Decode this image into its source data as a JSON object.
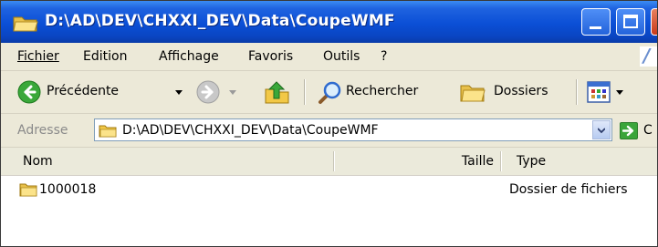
{
  "window": {
    "title": "D:\\AD\\DEV\\CHXXI_DEV\\Data\\CoupeWMF"
  },
  "menu": {
    "items": [
      {
        "label": "Fichier"
      },
      {
        "label": "Edition"
      },
      {
        "label": "Affichage"
      },
      {
        "label": "Favoris"
      },
      {
        "label": "Outils"
      },
      {
        "label": "?"
      }
    ]
  },
  "toolbar": {
    "back_label": "Précédente",
    "search_label": "Rechercher",
    "folders_label": "Dossiers"
  },
  "address": {
    "label": "Adresse",
    "value": "D:\\AD\\DEV\\CHXXI_DEV\\Data\\CoupeWMF",
    "go_label": "C"
  },
  "columns": {
    "name": "Nom",
    "size": "Taille",
    "type": "Type"
  },
  "files": [
    {
      "name": "1000018",
      "size": "",
      "type": "Dossier de fichiers"
    }
  ],
  "colors": {
    "titlebar": "#0b4fd6",
    "chrome": "#ece9d8",
    "folder": "#f4cf5a"
  }
}
